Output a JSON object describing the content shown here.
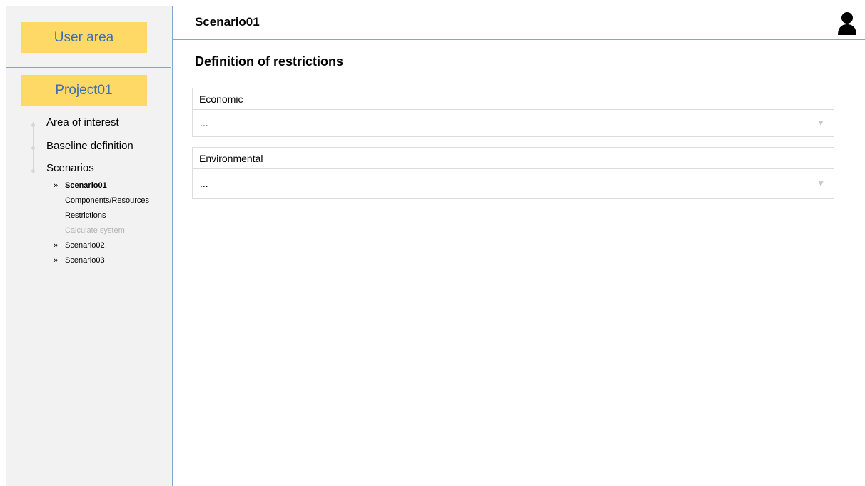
{
  "sidebar": {
    "user_area_label": "User area",
    "project_label": "Project01",
    "nav": {
      "area_of_interest": "Area of interest",
      "baseline_definition": "Baseline definition",
      "scenarios": "Scenarios"
    },
    "scenarios": {
      "bullet": "»",
      "scenario01": "Scenario01",
      "components": "Components/Resources",
      "restrictions": "Restrictions",
      "calculate": "Calculate system",
      "scenario02": "Scenario02",
      "scenario03": "Scenario03"
    }
  },
  "header": {
    "title": "Scenario01",
    "user_icon": "user-icon"
  },
  "main": {
    "section_title": "Definition of restrictions",
    "economic": {
      "label": "Economic",
      "value": "...",
      "caret": "▼"
    },
    "environmental": {
      "label": "Environmental",
      "value": "...",
      "caret": "▼"
    }
  },
  "colors": {
    "accent_yellow": "#ffd966",
    "link_blue": "#3d6fb4",
    "border_blue": "#7ea6d8",
    "sidebar_bg": "#f2f2f2"
  }
}
